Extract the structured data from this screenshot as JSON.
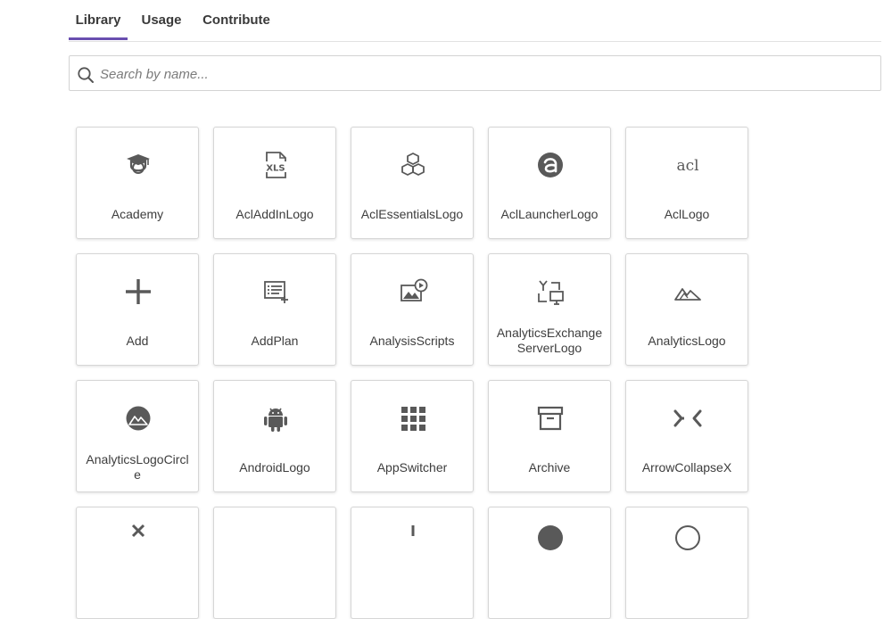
{
  "tabs": [
    {
      "label": "Library",
      "active": true
    },
    {
      "label": "Usage",
      "active": false
    },
    {
      "label": "Contribute",
      "active": false
    }
  ],
  "search": {
    "placeholder": "Search by name...",
    "value": ""
  },
  "colors": {
    "accent": "#6a4fb0",
    "icon": "#595959"
  },
  "icons": [
    {
      "label": "Academy",
      "icon": "academy-icon"
    },
    {
      "label": "AclAddInLogo",
      "icon": "xls-file-icon"
    },
    {
      "label": "AclEssentialsLogo",
      "icon": "cubes-icon"
    },
    {
      "label": "AclLauncherLogo",
      "icon": "launcher-logo-icon"
    },
    {
      "label": "AclLogo",
      "icon": "acl-logo-icon"
    },
    {
      "label": "Add",
      "icon": "plus-icon"
    },
    {
      "label": "AddPlan",
      "icon": "add-plan-icon"
    },
    {
      "label": "AnalysisScripts",
      "icon": "analysis-scripts-icon"
    },
    {
      "label": "AnalyticsExchangeServerLogo",
      "label_lines": [
        "AnalyticsExchange",
        "ServerLogo"
      ],
      "icon": "exchange-server-icon"
    },
    {
      "label": "AnalyticsLogo",
      "icon": "mountains-icon"
    },
    {
      "label": "AnalyticsLogoCircle",
      "label_lines": [
        "AnalyticsLogoCircl",
        "e"
      ],
      "icon": "mountains-circle-icon"
    },
    {
      "label": "AndroidLogo",
      "icon": "android-icon"
    },
    {
      "label": "AppSwitcher",
      "icon": "app-grid-icon"
    },
    {
      "label": "Archive",
      "icon": "archive-box-icon"
    },
    {
      "label": "ArrowCollapseX",
      "icon": "arrow-collapse-x-icon"
    }
  ]
}
